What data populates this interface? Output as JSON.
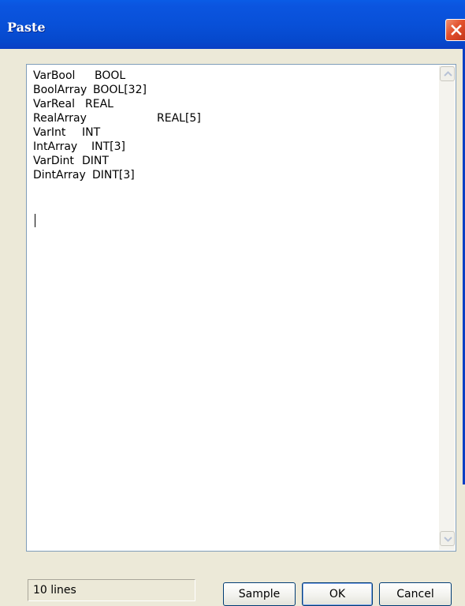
{
  "window": {
    "title": "Paste",
    "close_icon": "close-icon"
  },
  "editor": {
    "lines": [
      {
        "name": "VarBool",
        "type": "BOOL"
      },
      {
        "name": "BoolArray",
        "type": "BOOL[32]"
      },
      {
        "name": "VarReal",
        "type": "REAL"
      },
      {
        "name": "RealArray",
        "type": "REAL[5]"
      },
      {
        "name": "VarInt",
        "type": "INT"
      },
      {
        "name": "IntArray",
        "type": "INT[3]"
      },
      {
        "name": "VarDint",
        "type": "DINT"
      },
      {
        "name": "DintArray",
        "type": "DINT[3]"
      },
      {
        "name": "",
        "type": ""
      },
      {
        "name": "",
        "type": ""
      }
    ]
  },
  "footer": {
    "status": "10 lines",
    "sample_label": "Sample",
    "ok_label": "OK",
    "cancel_label": "Cancel"
  },
  "colors": {
    "titlebar": "#0a5ce6",
    "close_button": "#e2502c",
    "dialog_bg": "#ece9d8"
  }
}
